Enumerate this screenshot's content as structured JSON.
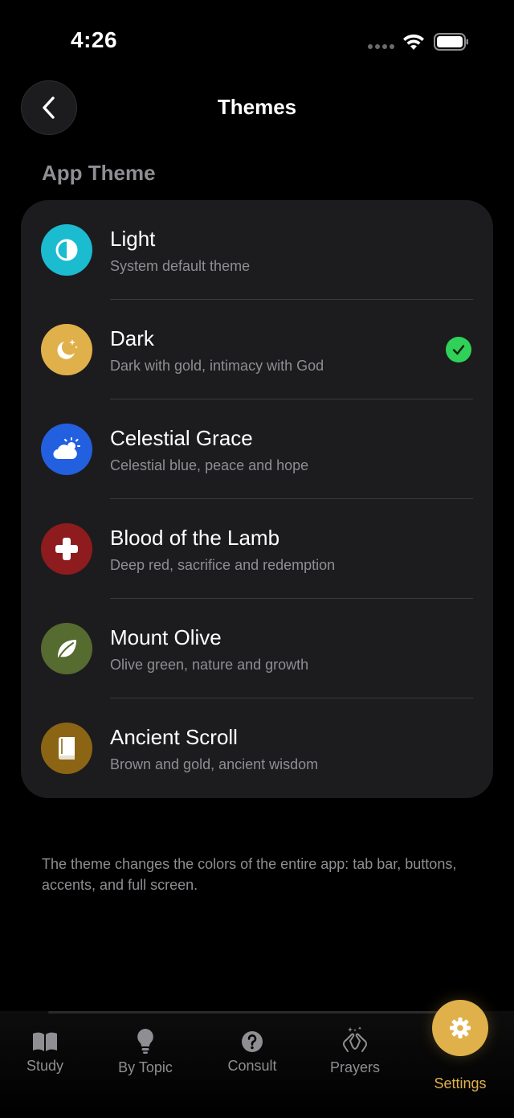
{
  "status_bar": {
    "time": "4:26"
  },
  "header": {
    "title": "Themes",
    "back_icon": "chevron-left-icon"
  },
  "section": {
    "label": "App Theme"
  },
  "themes": [
    {
      "name": "Light",
      "description": "System default theme",
      "icon": "half-circle-icon",
      "color": "#1bbbd0",
      "selected": false
    },
    {
      "name": "Dark",
      "description": "Dark with gold, intimacy with God",
      "icon": "moon-stars-icon",
      "color": "#e0b04a",
      "selected": true
    },
    {
      "name": "Celestial Grace",
      "description": "Celestial blue, peace and hope",
      "icon": "sun-cloud-icon",
      "color": "#2260e0",
      "selected": false
    },
    {
      "name": "Blood of the Lamb",
      "description": "Deep red, sacrifice and redemption",
      "icon": "cross-icon",
      "color": "#8e1b1d",
      "selected": false
    },
    {
      "name": "Mount Olive",
      "description": "Olive green, nature and growth",
      "icon": "leaf-icon",
      "color": "#556b2f",
      "selected": false
    },
    {
      "name": "Ancient Scroll",
      "description": "Brown and gold, ancient wisdom",
      "icon": "book-icon",
      "color": "#8b6514",
      "selected": false
    }
  ],
  "footnote": "The theme changes the colors of the entire app: tab bar, buttons, accents, and full screen.",
  "tab_bar": {
    "tabs": [
      {
        "label": "Study",
        "icon": "book-open-icon"
      },
      {
        "label": "By Topic",
        "icon": "lightbulb-icon"
      },
      {
        "label": "Consult",
        "icon": "question-circle-icon"
      },
      {
        "label": "Prayers",
        "icon": "praying-hands-icon"
      },
      {
        "label": "Settings",
        "icon": "gear-icon",
        "active": true
      }
    ],
    "active_color": "#e0b04a"
  }
}
